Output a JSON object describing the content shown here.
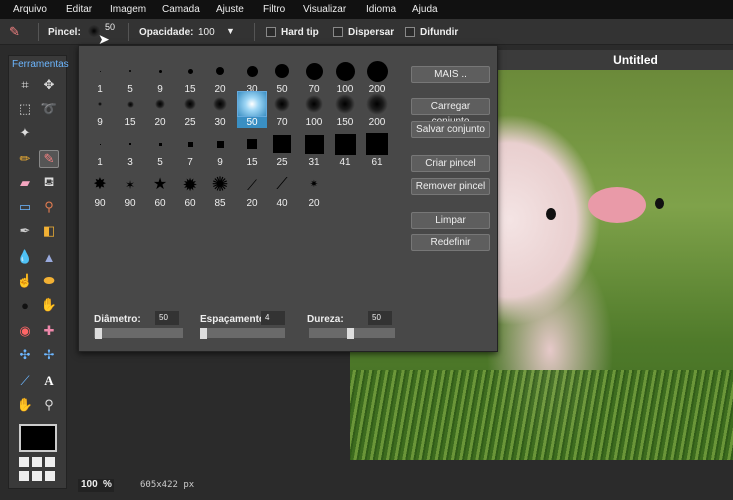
{
  "menu": [
    "Arquivo",
    "Editar",
    "Imagem",
    "Camada",
    "Ajuste",
    "Filtro",
    "Visualizar",
    "Idioma",
    "Ajuda"
  ],
  "options": {
    "brush_label": "Pincel:",
    "brush_size": "50",
    "opacity_label": "Opacidade:",
    "opacity_value": "100",
    "hard_tip": "Hard tip",
    "disperse": "Dispersar",
    "diffuse": "Difundir"
  },
  "tools": {
    "title": "Ferramentas",
    "icons": [
      "crop-icon",
      "move-icon",
      "marquee-icon",
      "lasso-icon",
      "magic-wand-icon",
      "pencil-icon",
      "brush-icon",
      "eraser-icon",
      "paint-bucket-icon",
      "gradient-icon",
      "clone-stamp-icon",
      "color-replace-icon",
      "drawing-icon",
      "blur-icon",
      "sharpen-icon",
      "smudge-icon",
      "sponge-icon",
      "dodge-icon",
      "burn-icon",
      "red-eye-icon",
      "spot-heal-icon",
      "bloat-icon",
      "pinch-icon",
      "color-picker-icon",
      "type-icon",
      "hand-icon",
      "zoom-icon"
    ],
    "primary_color": "#000000"
  },
  "document": {
    "title": "Untitled"
  },
  "status": {
    "zoom": "100",
    "zoom_unit": "%",
    "dimensions": "605x422 px"
  },
  "brush_popup": {
    "rows": [
      {
        "labels": [
          "1",
          "5",
          "9",
          "15",
          "20",
          "30",
          "50",
          "70",
          "100",
          "200"
        ]
      },
      {
        "labels": [
          "9",
          "15",
          "20",
          "25",
          "30",
          "50",
          "70",
          "100",
          "150",
          "200"
        ]
      },
      {
        "labels": [
          "1",
          "3",
          "5",
          "7",
          "9",
          "15",
          "25",
          "31",
          "41",
          "61"
        ]
      },
      {
        "labels": [
          "90",
          "90",
          "60",
          "60",
          "85",
          "20",
          "40",
          "20"
        ]
      }
    ],
    "selected": "50",
    "buttons": [
      "MAIS ..",
      "Carregar conjunto",
      "Salvar conjunto",
      "Criar pincel",
      "Remover pincel",
      "Limpar",
      "Redefinir"
    ],
    "diameter_label": "Diâmetro:",
    "diameter_value": "50",
    "spacing_label": "Espaçamento",
    "spacing_value": "4",
    "hardness_label": "Dureza:",
    "hardness_value": "50"
  },
  "colors": {
    "accent": "#3a8fc3",
    "tools_title": "#6cb6ff"
  }
}
